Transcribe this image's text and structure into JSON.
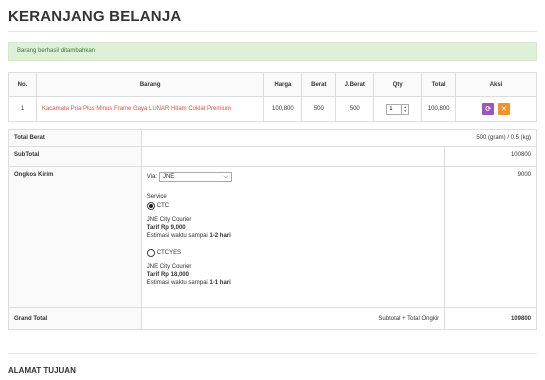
{
  "page_title": "KERANJANG BELANJA",
  "alert_text": "Barang berhasil ditambahkan",
  "cart": {
    "headers": [
      "No.",
      "Barang",
      "Harga",
      "Berat",
      "J.Berat",
      "Qty",
      "Total",
      "Aksi"
    ],
    "rows": [
      {
        "no": "1",
        "product": "Kacamata Pria Plus Minus Frame Gaya LUNAR Hitam Coklat Premium",
        "price": "100,800",
        "weight": "500",
        "total_weight": "500",
        "qty": "1",
        "total": "100,800"
      }
    ],
    "refresh_icon": "refresh-icon",
    "delete_icon": "close-icon",
    "refresh_color": "#9b59b6",
    "delete_color": "#f0932b"
  },
  "summary": {
    "total_weight_label": "Total Berat",
    "total_weight_value": "500 (gram) / 0.5 (kg)",
    "subtotal_label": "SubTotal",
    "subtotal_value": "100800",
    "shipping_label": "Ongkos Kirim",
    "shipping_value": "9000",
    "via_label": "Via:",
    "courier": "JNE",
    "service_label": "Service",
    "options": [
      {
        "code": "CTC",
        "name": "JNE City Courier",
        "tarif_label": "Tarif",
        "tarif": "Rp 9,000",
        "estimasi_label": "Estimasi waktu sampai",
        "estimasi": "1-2 hari",
        "selected": true
      },
      {
        "code": "CTCYES",
        "name": "JNE City Courier",
        "tarif_label": "Tarif",
        "tarif": "Rp 18,000",
        "estimasi_label": "Estimasi waktu sampai",
        "estimasi": "1-1 hari",
        "selected": false
      }
    ],
    "grand_total_label": "Grand Total",
    "grand_total_formula": "Subtotal + Total Ongkir",
    "grand_total_value": "109800"
  },
  "section_title": "ALAMAT TUJUAN"
}
